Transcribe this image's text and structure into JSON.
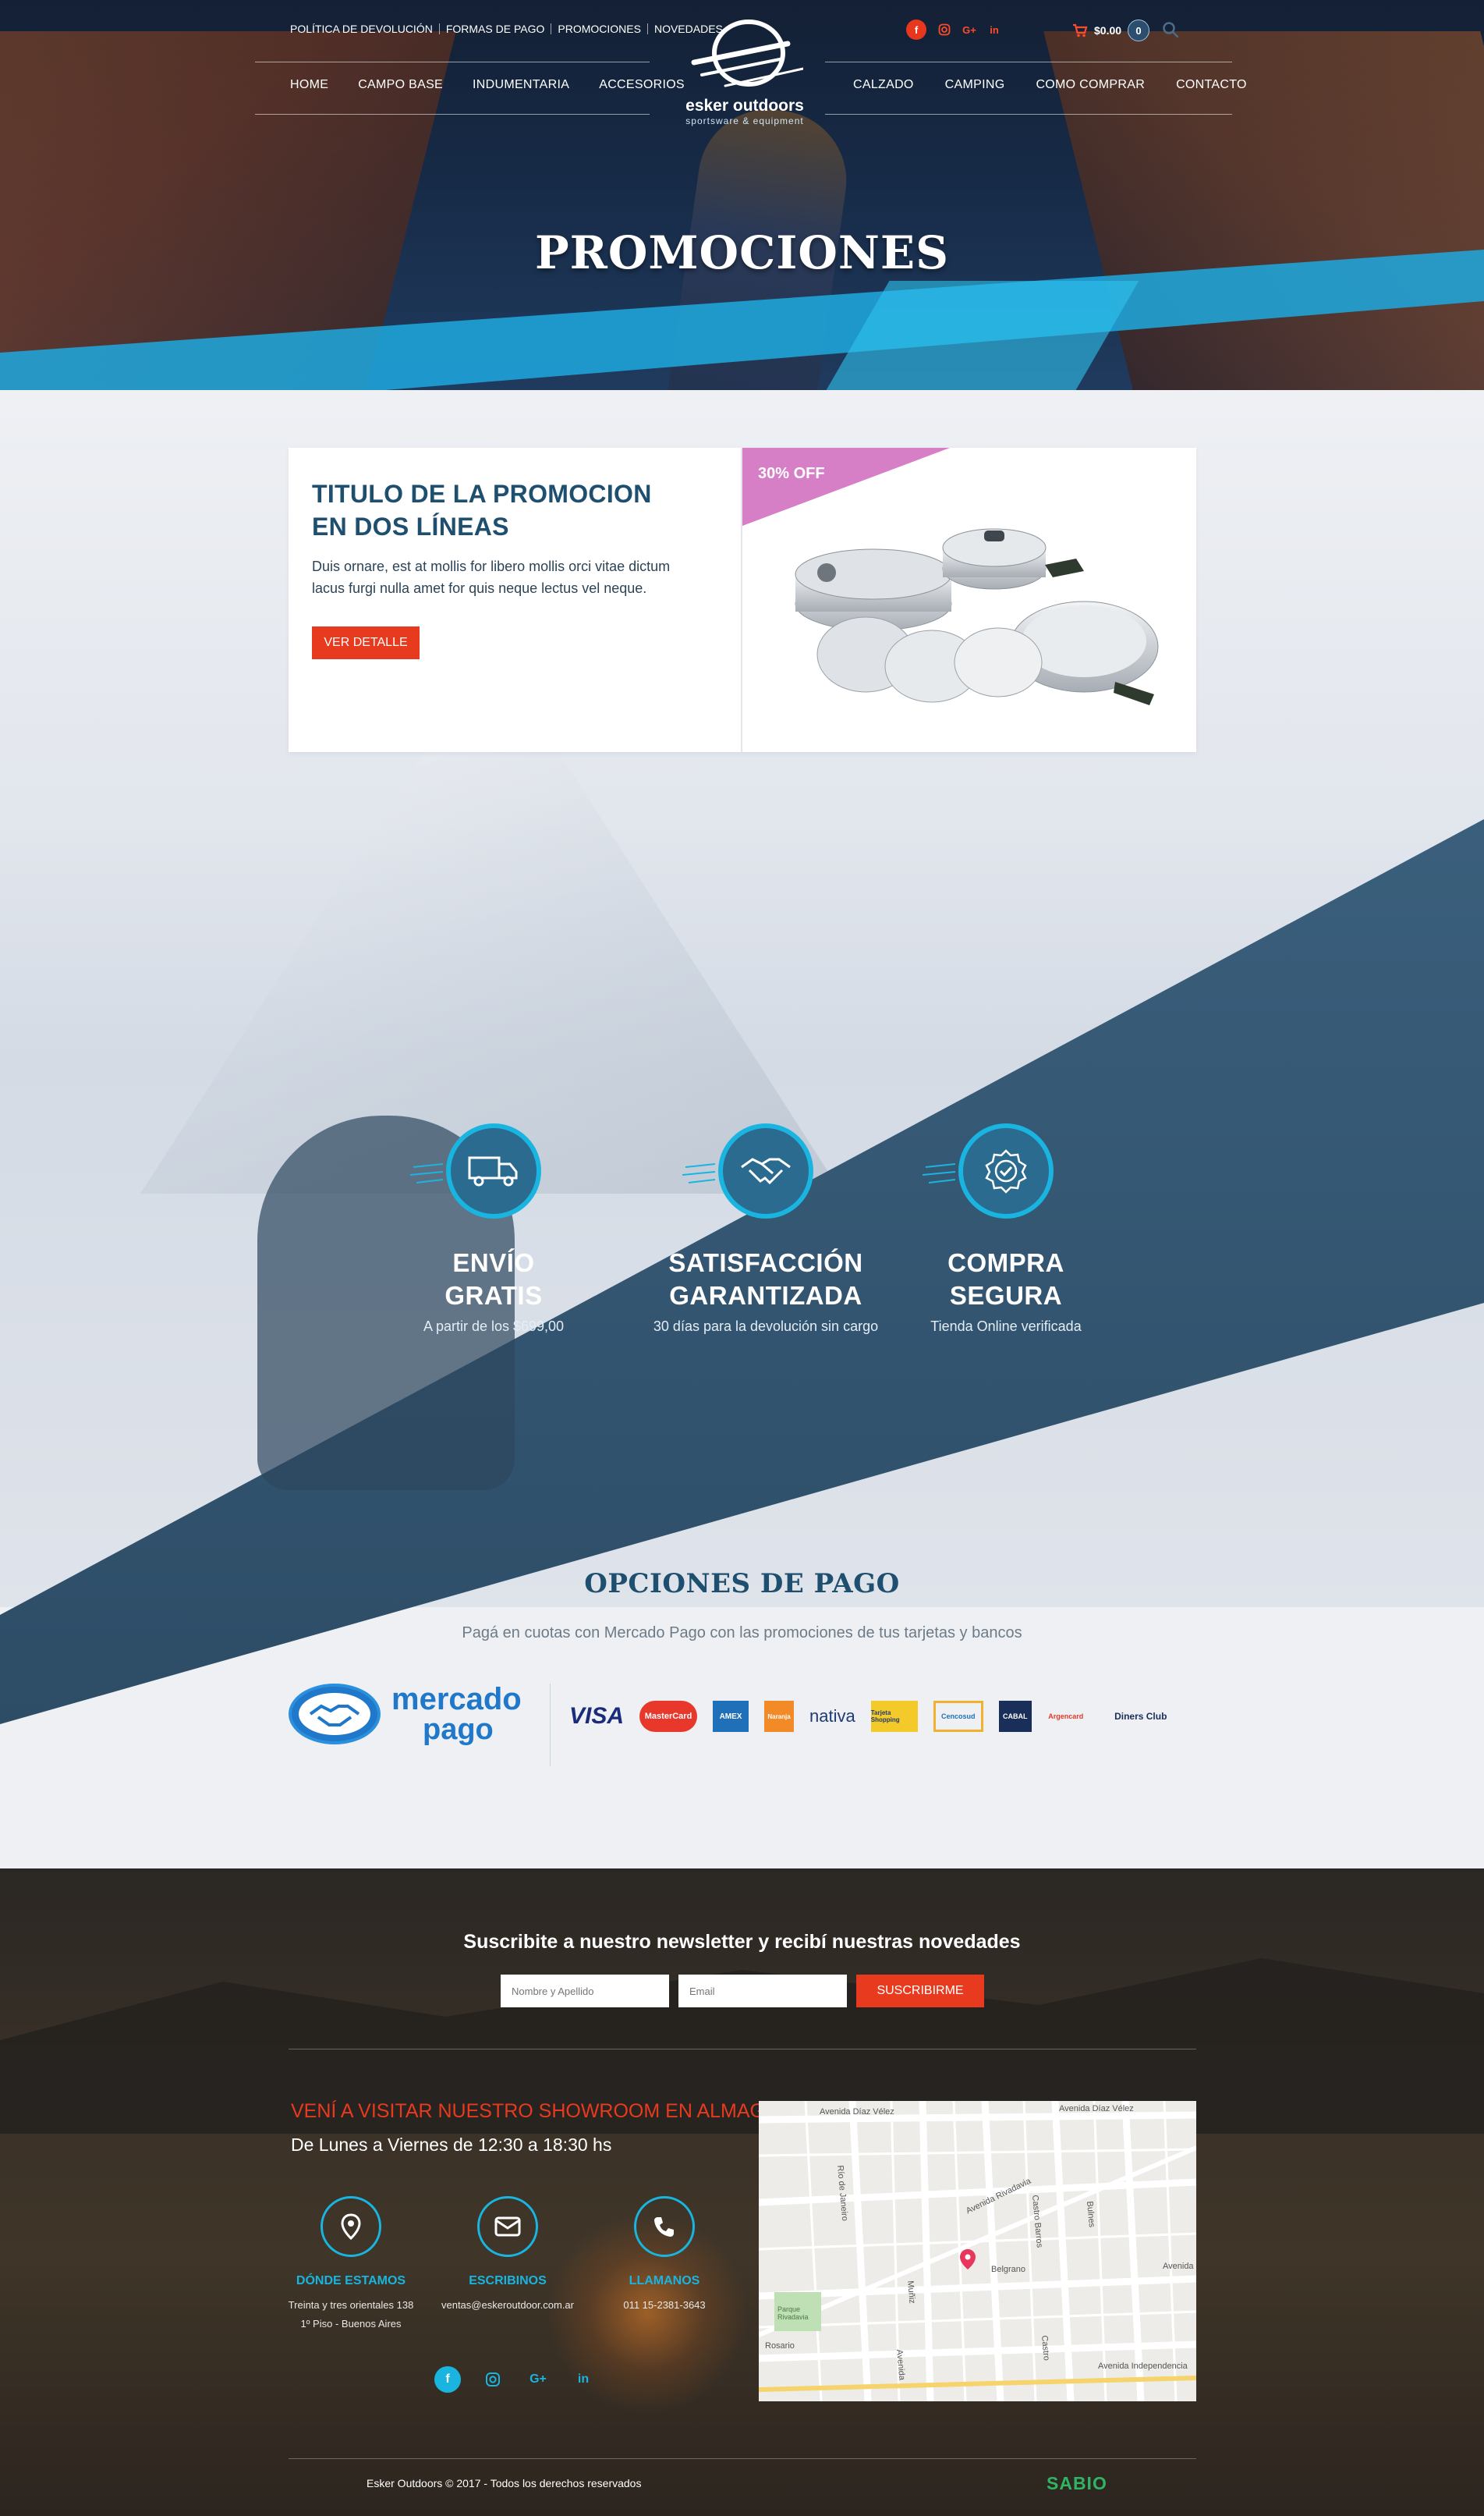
{
  "header": {
    "top_links": [
      "POLÍTICA DE DEVOLUCIÓN",
      "FORMAS DE PAGO",
      "PROMOCIONES",
      "NOVEDADES"
    ],
    "nav_left": [
      "HOME",
      "CAMPO BASE",
      "INDUMENTARIA",
      "ACCESORIOS"
    ],
    "nav_right": [
      "CALZADO",
      "CAMPING",
      "COMO COMPRAR",
      "CONTACTO"
    ],
    "logo": {
      "brand": "esker outdoors",
      "tagline": "sportsware & equipment"
    },
    "social": [
      "f",
      "ig",
      "G+",
      "in"
    ],
    "cart_total": "$0.00",
    "cart_count": "0",
    "icons": {
      "cart": "cart-icon",
      "search": "search-icon"
    }
  },
  "hero": {
    "title": "PROMOCIONES"
  },
  "promo": {
    "title": "TITULO DE LA PROMOCION EN DOS LÍNEAS",
    "text": "Duis ornare, est at mollis for libero mollis orci vitae dictum lacus furgi nulla amet for quis neque lectus vel neque.",
    "button": "VER DETALLE",
    "discount": "30% OFF"
  },
  "features": [
    {
      "title_1": "ENVÍO",
      "title_2": "GRATIS",
      "subtitle": "A partir de los $699,00",
      "icon": "truck-icon"
    },
    {
      "title_1": "SATISFACCIÓN",
      "title_2": "GARANTIZADA",
      "subtitle": "30 días para la devolución sin cargo",
      "icon": "handshake-icon"
    },
    {
      "title_1": "COMPRA",
      "title_2": "SEGURA",
      "subtitle": "Tienda Online verificada",
      "icon": "verified-badge-icon"
    }
  ],
  "payment": {
    "title": "OPCIONES DE PAGO",
    "subtitle": "Pagá en cuotas con Mercado Pago con las promociones de tus tarjetas y bancos",
    "mercado_pago": {
      "line1": "mercado",
      "line2": "pago"
    },
    "cards": [
      "VISA",
      "MasterCard",
      "AMEX",
      "Naranja",
      "nativa",
      "Tarjeta Shopping",
      "Cencosud",
      "CABAL",
      "Argencard",
      "Diners Club"
    ]
  },
  "footer": {
    "newsletter_title": "Suscribite a nuestro newsletter y recibí nuestras novedades",
    "name_placeholder": "Nombre y Apellido",
    "email_placeholder": "Email",
    "subscribe": "SUSCRIBIRME",
    "showroom": "VENÍ A VISITAR NUESTRO SHOWROOM EN ALMAGRO",
    "hours": "De Lunes a Viernes de 12:30 a 18:30 hs",
    "contacts": [
      {
        "title": "DÓNDE ESTAMOS",
        "value_1": "Treinta y tres orientales 138",
        "value_2": "1º Piso - Buenos Aires",
        "icon": "location-pin-icon"
      },
      {
        "title": "ESCRIBINOS",
        "value_1": "ventas@eskeroutdoor.com.ar",
        "value_2": "",
        "icon": "email-icon"
      },
      {
        "title": "LLAMANOS",
        "value_1": "011 15-2381-3643",
        "value_2": "",
        "icon": "phone-icon"
      }
    ],
    "social": [
      "f",
      "ig",
      "G+",
      "in"
    ],
    "map_labels": [
      "Avenida Díaz Vélez",
      "Avenida Díaz Vélez",
      "Río de Janeiro",
      "Avenida Rivadavia",
      "Castro Barros",
      "Bulnes",
      "Belgrano",
      "Avenida",
      "Muñiz",
      "Parque Rivadavia",
      "Rosario",
      "Castro",
      "Avenida",
      "Avenida Independencia"
    ],
    "copyright": "Esker Outdoors © 2017 - Todos los derechos reservados",
    "credit": "SABIO"
  },
  "colors": {
    "accent_red": "#e83a1e",
    "accent_blue": "#19b5e0",
    "navy": "#1f4f6e",
    "pink": "#d77fc6"
  }
}
